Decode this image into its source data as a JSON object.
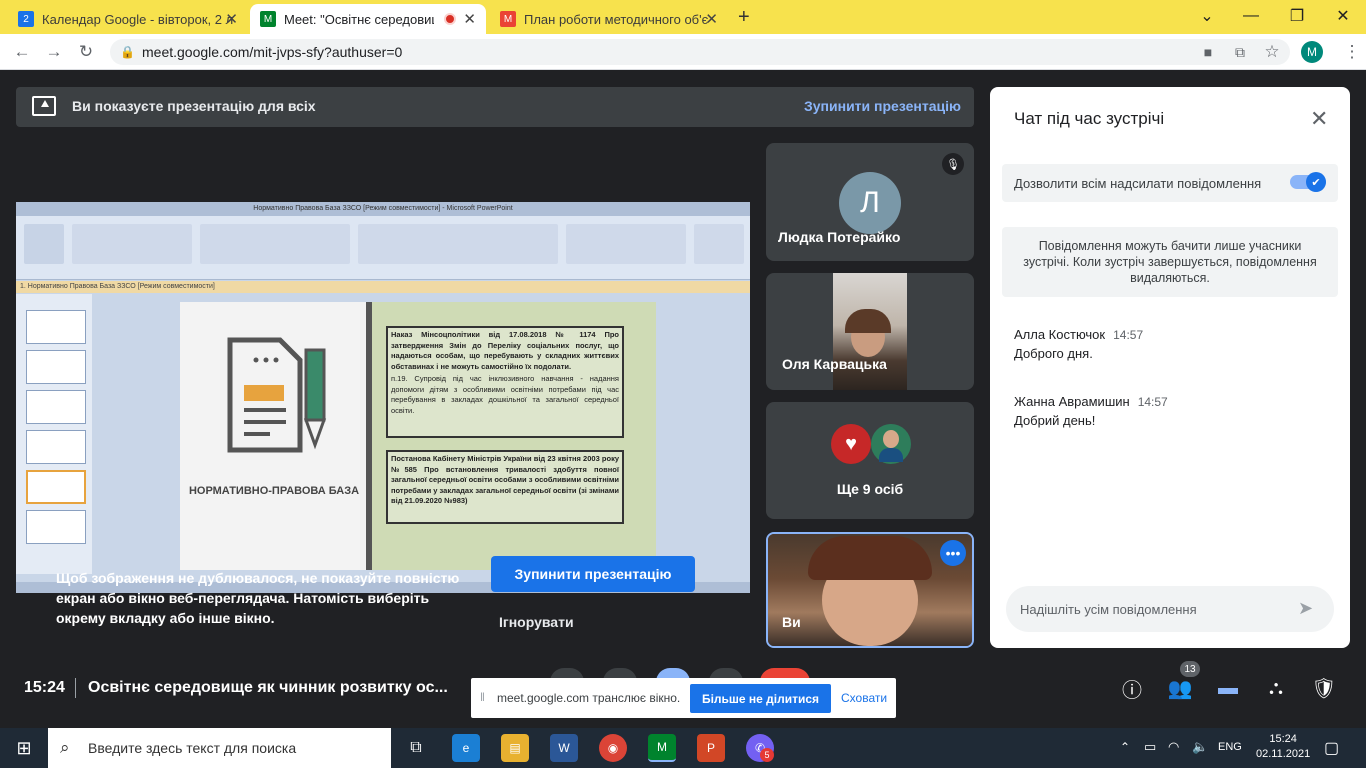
{
  "browser": {
    "tabs": [
      {
        "label": "Календар Google - вівторок, 2 л",
        "favicon": "2",
        "color": "#1a73e8"
      },
      {
        "label": "Meet: \"Освітнє середовище",
        "favicon": "M",
        "color": "#00832d"
      },
      {
        "label": "План роботи методичного об'є",
        "favicon": "M",
        "color": "#ea4335"
      }
    ],
    "new_tab": "+",
    "url": "meet.google.com/mit-jvps-sfy?authuser=0",
    "profile_initial": "M"
  },
  "presentation_bar": {
    "text": "Ви показуєте презентацію для всіх",
    "stop_link": "Зупинити презентацію"
  },
  "shared_screen": {
    "window_title": "Нормативно Правова База ЗЗСО [Режим совместимости] - Microsoft PowerPoint",
    "doc_tab": "1. Нормативно Правова База ЗЗСО [Режим совместимости]",
    "slide_label": "НОРМАТИВНО-ПРАВОВА БАЗА",
    "box1": "Наказ Мінсоцполітики від 17.08.2018 № 1174 Про затвердження Змін до Переліку соціальних послуг, що надаються особам, що перебувають у складних життєвих обставинах і не можуть самостійно їх подолати.",
    "box1_sub": "п.19. Супровід під час інклюзивного навчання - надання допомоги дітям з особливими освітніми потребами під час перебування в закладах дошкільної та загальної середньої освіти.",
    "box2": "Постанова Кабінету Міністрів України від 23 квітня 2003 року №585 Про встановлення тривалості здобуття повної загальної середньої освіти особами з особливими освітніми потребами у закладах загальної середньої освіти (зі змінами від 21.09.2020 №983)"
  },
  "warning": {
    "text": "Щоб зображення не дублювалося, не показуйте повністю екран або вікно веб-переглядача. Натомість виберіть окрему вкладку або інше вікно.",
    "stop_button": "Зупинити презентацію",
    "ignore": "Ігнорувати"
  },
  "participants": [
    {
      "name": "Людка Потерайко",
      "initial": "Л"
    },
    {
      "name": "Оля Карвацька"
    },
    {
      "name": "Ще 9 осіб"
    },
    {
      "name": "Ви"
    }
  ],
  "chat": {
    "title": "Чат під час зустрічі",
    "allow_label": "Дозволити всім надсилати повідомлення",
    "allow_enabled": true,
    "note": "Повідомлення можуть бачити лише учасники зустрічі. Коли зустріч завершується, повідомлення видаляються.",
    "messages": [
      {
        "author": "Алла Костючок",
        "time": "14:57",
        "text": "Доброго дня."
      },
      {
        "author": "Жанна Аврамишин",
        "time": "14:57",
        "text": "Добрий день!"
      }
    ],
    "input_placeholder": "Надішліть усім повідомлення"
  },
  "bottom_bar": {
    "time": "15:24",
    "meeting_title": "Освітнє середовище як чинник розвитку ос...",
    "people_count": "13"
  },
  "share_notice": {
    "text": "meet.google.com транслює вікно.",
    "stop_button": "Більше не ділитися",
    "hide": "Сховати"
  },
  "taskbar": {
    "search_placeholder": "Введите здесь текст для поиска",
    "lang": "ENG",
    "time": "15:24",
    "date": "02.11.2021",
    "viber_badge": "5"
  }
}
